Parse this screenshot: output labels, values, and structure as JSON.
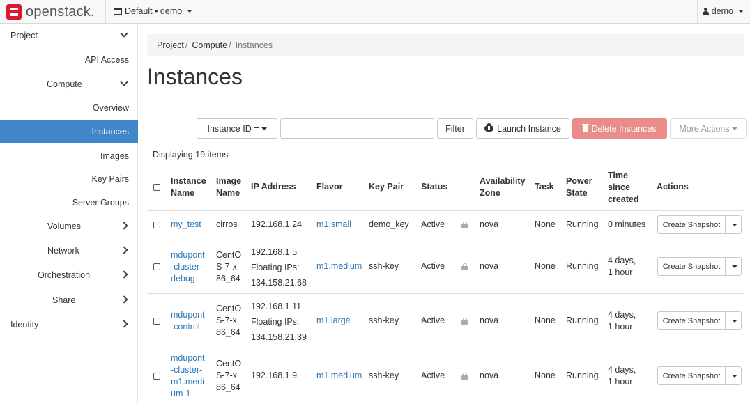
{
  "app": {
    "name": "openstack."
  },
  "topbar": {
    "project_selector": "Default • demo",
    "user": "demo"
  },
  "sidebar": {
    "project": "Project",
    "api_access": "API Access",
    "compute": "Compute",
    "overview": "Overview",
    "instances": "Instances",
    "images": "Images",
    "key_pairs": "Key Pairs",
    "server_groups": "Server Groups",
    "volumes": "Volumes",
    "network": "Network",
    "orchestration": "Orchestration",
    "share": "Share",
    "identity": "Identity"
  },
  "breadcrumb": {
    "project": "Project",
    "compute": "Compute",
    "current": "Instances",
    "sep": "/"
  },
  "page": {
    "title": "Instances",
    "displaying": "Displaying 19 items"
  },
  "toolbar": {
    "filter_field": "Instance ID =",
    "filter_value": "",
    "filter": "Filter",
    "launch": "Launch Instance",
    "delete": "Delete Instances",
    "more": "More Actions"
  },
  "table": {
    "headers": {
      "name_1": "Instance",
      "name_2": "Name",
      "image_1": "Image",
      "image_2": "Name",
      "ip": "IP Address",
      "flavor": "Flavor",
      "keypair": "Key Pair",
      "status": "Status",
      "az_1": "Availability",
      "az_2": "Zone",
      "task": "Task",
      "power_1": "Power",
      "power_2": "State",
      "time_1": "Time",
      "time_2": "since",
      "time_3": "created",
      "actions": "Actions"
    },
    "rows": [
      {
        "name": [
          "my_test"
        ],
        "image": [
          "cirros"
        ],
        "ip": [
          "192.168.1.24"
        ],
        "flavor": "m1.small",
        "keypair": "demo_key",
        "status": "Active",
        "az": "nova",
        "task": "None",
        "power": "Running",
        "age": [
          "0 minutes"
        ],
        "action": "Create Snapshot"
      },
      {
        "name": [
          "mdupont",
          "-cluster-",
          "debug"
        ],
        "image": [
          "CentO",
          "S-7-x",
          "86_64"
        ],
        "ip": [
          "192.168.1.5",
          "Floating IPs:",
          "134.158.21.68"
        ],
        "flavor": "m1.medium",
        "keypair": "ssh-key",
        "status": "Active",
        "az": "nova",
        "task": "None",
        "power": "Running",
        "age": [
          "4 days,",
          "1 hour"
        ],
        "action": "Create Snapshot"
      },
      {
        "name": [
          "mdupont",
          "-control"
        ],
        "image": [
          "CentO",
          "S-7-x",
          "86_64"
        ],
        "ip": [
          "192.168.1.11",
          "Floating IPs:",
          "134.158.21.39"
        ],
        "flavor": "m1.large",
        "keypair": "ssh-key",
        "status": "Active",
        "az": "nova",
        "task": "None",
        "power": "Running",
        "age": [
          "4 days,",
          "1 hour"
        ],
        "action": "Create Snapshot"
      },
      {
        "name": [
          "mdupont",
          "-cluster-",
          "m1.medi",
          "um-1"
        ],
        "image": [
          "CentO",
          "S-7-x",
          "86_64"
        ],
        "ip": [
          "192.168.1.9"
        ],
        "flavor": "m1.medium",
        "keypair": "ssh-key",
        "status": "Active",
        "az": "nova",
        "task": "None",
        "power": "Running",
        "age": [
          "4 days,",
          "1 hour"
        ],
        "action": "Create Snapshot"
      }
    ]
  }
}
